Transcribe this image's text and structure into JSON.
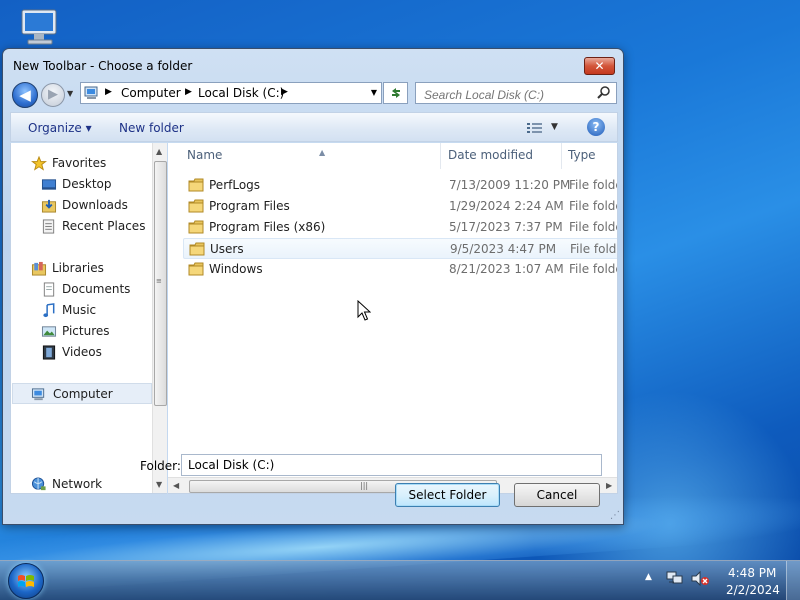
{
  "window": {
    "title": "New Toolbar - Choose a folder",
    "close_symbol": "✕"
  },
  "nav": {
    "back_symbol": "◀",
    "forward_symbol": "▶"
  },
  "address": {
    "crumbs": [
      "Computer",
      "Local Disk (C:)"
    ]
  },
  "search": {
    "placeholder": "Search Local Disk (C:)"
  },
  "toolbar": {
    "organize_label": "Organize ▾",
    "new_folder_label": "New folder",
    "help_symbol": "?"
  },
  "sidebar": {
    "items": [
      {
        "label": "Favorites",
        "icon": "star-icon"
      },
      {
        "label": "Desktop",
        "icon": "desktop-icon"
      },
      {
        "label": "Downloads",
        "icon": "downloads-icon"
      },
      {
        "label": "Recent Places",
        "icon": "recent-places-icon"
      },
      {
        "label": "Libraries",
        "icon": "libraries-icon"
      },
      {
        "label": "Documents",
        "icon": "documents-icon"
      },
      {
        "label": "Music",
        "icon": "music-icon"
      },
      {
        "label": "Pictures",
        "icon": "pictures-icon"
      },
      {
        "label": "Videos",
        "icon": "videos-icon"
      },
      {
        "label": "Computer",
        "icon": "computer-icon"
      },
      {
        "label": "Network",
        "icon": "network-icon"
      }
    ],
    "selected": "Computer"
  },
  "filelist": {
    "columns": [
      "Name",
      "Date modified",
      "Type"
    ],
    "rows": [
      {
        "name": "PerfLogs",
        "date": "7/13/2009 11:20 PM",
        "type": "File folder"
      },
      {
        "name": "Program Files",
        "date": "1/29/2024 2:24 AM",
        "type": "File folder"
      },
      {
        "name": "Program Files (x86)",
        "date": "5/17/2023 7:37 PM",
        "type": "File folder"
      },
      {
        "name": "Users",
        "date": "9/5/2023 4:47 PM",
        "type": "File folder"
      },
      {
        "name": "Windows",
        "date": "8/21/2023 1:07 AM",
        "type": "File folder"
      }
    ],
    "hovered": "Users"
  },
  "footer": {
    "folder_label": "Folder:",
    "folder_value": "Local Disk (C:)",
    "select_label": "Select Folder",
    "cancel_label": "Cancel"
  },
  "taskbar": {
    "time": "4:48 PM",
    "date": "2/2/2024",
    "tray_arrow": "▲"
  }
}
